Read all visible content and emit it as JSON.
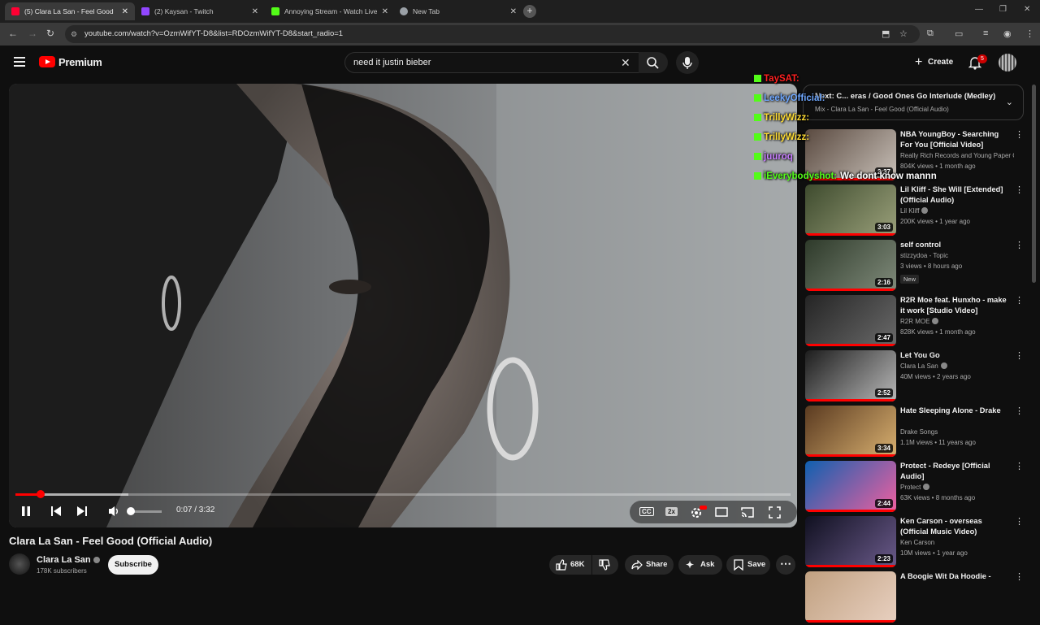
{
  "browser": {
    "tabs": [
      {
        "title": "(5) Clara La San - Feel Good",
        "favicon_color": "#ff0033",
        "active": true
      },
      {
        "title": "(2) Kaysan - Twitch",
        "favicon_color": "#9146ff",
        "active": false
      },
      {
        "title": "Annoying Stream - Watch Live",
        "favicon_color": "#53fc18",
        "active": false
      },
      {
        "title": "New Tab",
        "favicon_color": "#9aa0a6",
        "active": false
      }
    ],
    "url": "youtube.com/watch?v=OzmWifYT-D8&list=RDOzmWifYT-D8&start_radio=1"
  },
  "header": {
    "brand": "Premium",
    "search_value": "need it justin bieber",
    "create_label": "Create",
    "notif_count": "5"
  },
  "player": {
    "time": "0:07 / 3:32",
    "progress_fraction": 0.033,
    "buffered_fraction": 0.146,
    "volume_fraction": 0.05,
    "speed_badge": "2x",
    "cc_label": "CC"
  },
  "video": {
    "title": "Clara La San - Feel Good (Official Audio)",
    "channel": "Clara La San",
    "subscribers": "178K subscribers",
    "subscribe_label": "Subscribe",
    "likes": "68K",
    "share_label": "Share",
    "ask_label": "Ask",
    "save_label": "Save"
  },
  "up_next": {
    "title": "Next: C... eras / Good Ones Go Interlude (Medley)",
    "subtitle": "Mix - Clara La San - Feel Good (Official Audio)"
  },
  "chat": [
    {
      "user": "TaySAT:",
      "text": "",
      "color": "#ff2020"
    },
    {
      "user": "LeekyOfficial:",
      "text": "",
      "color": "#6fa8ff"
    },
    {
      "user": "TrillyWizz:",
      "text": "",
      "color": "#ffdd33"
    },
    {
      "user": "TrillyWizz:",
      "text": "",
      "color": "#ffdd33"
    },
    {
      "user": "juuroq",
      "text": "",
      "color": "#c77dff"
    },
    {
      "user": "iEverybodyshot:",
      "text": "We dont know mannn",
      "color": "#53fc18"
    }
  ],
  "recommendations": [
    {
      "title": "NBA YoungBoy - Searching For You [Official Video]",
      "channel": "Really Rich Records and Young Paper Ch...",
      "meta": "804K views • 1 month ago",
      "duration": "2:37",
      "verified": false,
      "new": false
    },
    {
      "title": "Lil Kliff - She Will [Extended] (Official Audio)",
      "channel": "Lil Kliff",
      "meta": "200K views • 1 year ago",
      "duration": "3:03",
      "verified": true,
      "new": false
    },
    {
      "title": "self control",
      "channel": "stizzydoa - Topic",
      "meta": "3 views • 8 hours ago",
      "duration": "2:16",
      "verified": false,
      "new": true,
      "new_label": "New"
    },
    {
      "title": "R2R Moe feat. Hunxho - make it work [Studio Video]",
      "channel": "R2R MOE",
      "meta": "828K views • 1 month ago",
      "duration": "2:47",
      "verified": true,
      "new": false
    },
    {
      "title": "Let You Go",
      "channel": "Clara La San",
      "meta": "40M views • 2 years ago",
      "duration": "2:52",
      "verified": true,
      "new": false
    },
    {
      "title": "Hate Sleeping Alone - Drake",
      "channel": "Drake Songs",
      "meta": "1.1M views • 11 years ago",
      "duration": "3:34",
      "verified": false,
      "new": false
    },
    {
      "title": "Protect - Redeye [Official Audio]",
      "channel": "Protect",
      "meta": "63K views • 8 months ago",
      "duration": "2:44",
      "verified": true,
      "new": false
    },
    {
      "title": "Ken Carson - overseas (Official Music Video)",
      "channel": "Ken Carson",
      "meta": "10M views • 1 year ago",
      "duration": "2:23",
      "verified": false,
      "new": false
    },
    {
      "title": "A Boogie Wit Da Hoodie -",
      "channel": "",
      "meta": "",
      "duration": "",
      "verified": false,
      "new": false
    }
  ]
}
